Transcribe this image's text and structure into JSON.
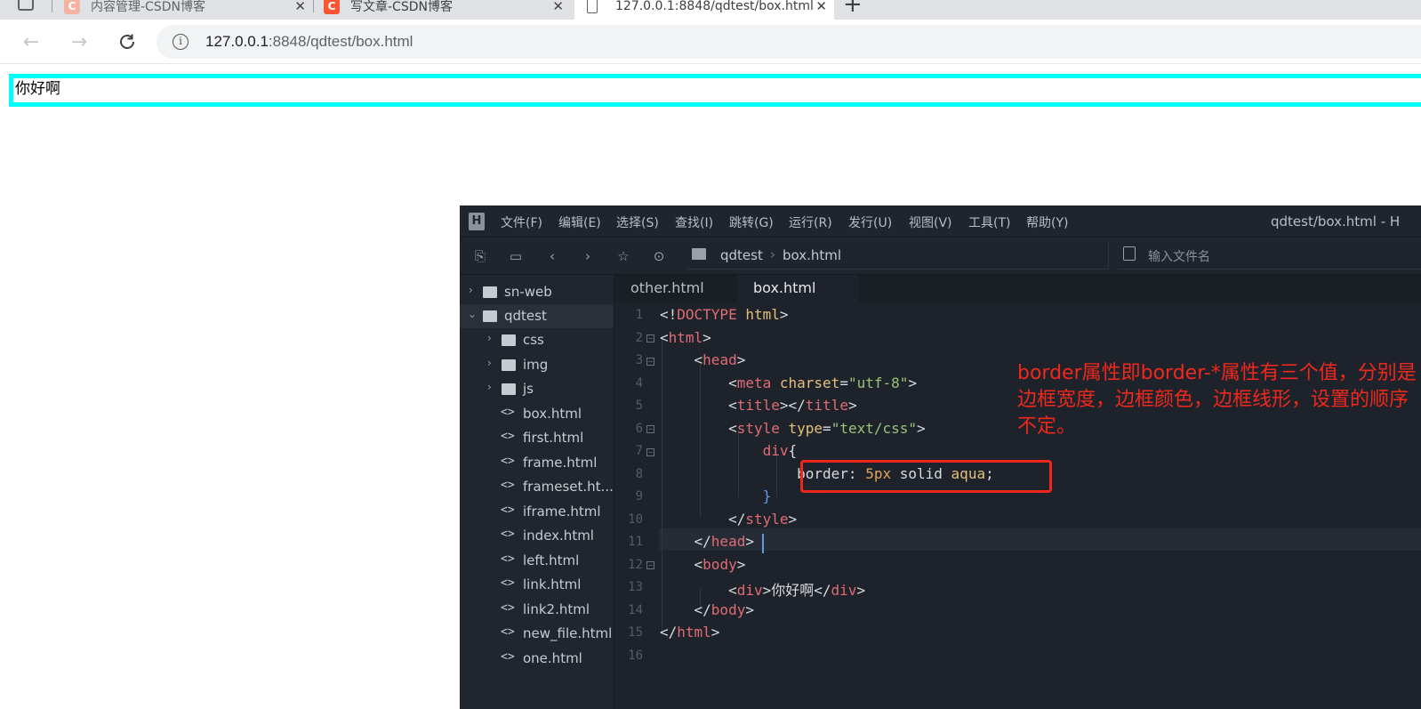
{
  "browser": {
    "tabs": [
      {
        "title": "内容管理-CSDN博客"
      },
      {
        "title": "写文章-CSDN博客"
      },
      {
        "title": "127.0.0.1:8848/qdtest/box.html"
      }
    ],
    "new_tab_label": "+",
    "address": {
      "host": "127.0.0.1",
      "rest": ":8848/qdtest/box.html"
    }
  },
  "page": {
    "div_text": "你好啊"
  },
  "ide": {
    "menu": [
      "文件(F)",
      "编辑(E)",
      "选择(S)",
      "查找(I)",
      "跳转(G)",
      "运行(R)",
      "发行(U)",
      "视图(V)",
      "工具(T)",
      "帮助(Y)"
    ],
    "window_title": "qdtest/box.html - H",
    "breadcrumb": [
      "qdtest",
      "box.html"
    ],
    "file_search_placeholder": "输入文件名",
    "tree": [
      {
        "label": "sn-web",
        "kind": "project",
        "state": "collapsed"
      },
      {
        "label": "qdtest",
        "kind": "project",
        "state": "expanded"
      },
      {
        "label": "css",
        "kind": "folder"
      },
      {
        "label": "img",
        "kind": "folder"
      },
      {
        "label": "js",
        "kind": "folder"
      },
      {
        "label": "box.html",
        "kind": "file"
      },
      {
        "label": "first.html",
        "kind": "file"
      },
      {
        "label": "frame.html",
        "kind": "file"
      },
      {
        "label": "frameset.ht...",
        "kind": "file"
      },
      {
        "label": "iframe.html",
        "kind": "file"
      },
      {
        "label": "index.html",
        "kind": "file"
      },
      {
        "label": "left.html",
        "kind": "file"
      },
      {
        "label": "link.html",
        "kind": "file"
      },
      {
        "label": "link2.html",
        "kind": "file"
      },
      {
        "label": "new_file.html",
        "kind": "file"
      },
      {
        "label": "one.html",
        "kind": "file"
      }
    ],
    "editor_tabs": [
      {
        "label": "other.html",
        "active": false
      },
      {
        "label": "box.html",
        "active": true
      }
    ],
    "code": {
      "line_numbers": [
        "1",
        "2",
        "3",
        "4",
        "5",
        "6",
        "7",
        "8",
        "9",
        "10",
        "11",
        "12",
        "13",
        "14",
        "15",
        "16"
      ],
      "text": {
        "l1_doctype": "DOCTYPE",
        "l1_html": "html",
        "l2_html": "html",
        "l3_head": "head",
        "l4_meta": "meta",
        "l4_attr": "charset",
        "l4_val": "\"utf-8\"",
        "l5_title": "title",
        "l6_style": "style",
        "l6_attr": "type",
        "l6_val": "\"text/css\"",
        "l7_sel": "div",
        "l8_prop": "border",
        "l8_num": "5px",
        "l8_kw": "solid",
        "l8_color": "aqua",
        "l10_style": "style",
        "l11_head": "head",
        "l12_body": "body",
        "l13_div": "div",
        "l13_text": "你好啊",
        "l14_body": "body",
        "l15_html": "html"
      }
    },
    "annotation": "border属性即border-*属性有三个值，分别是边框宽度，边框颜色，边框线形，设置的顺序不定。"
  },
  "colors": {
    "demo_border": "#00ffff",
    "annotation_red": "#f0281c"
  }
}
